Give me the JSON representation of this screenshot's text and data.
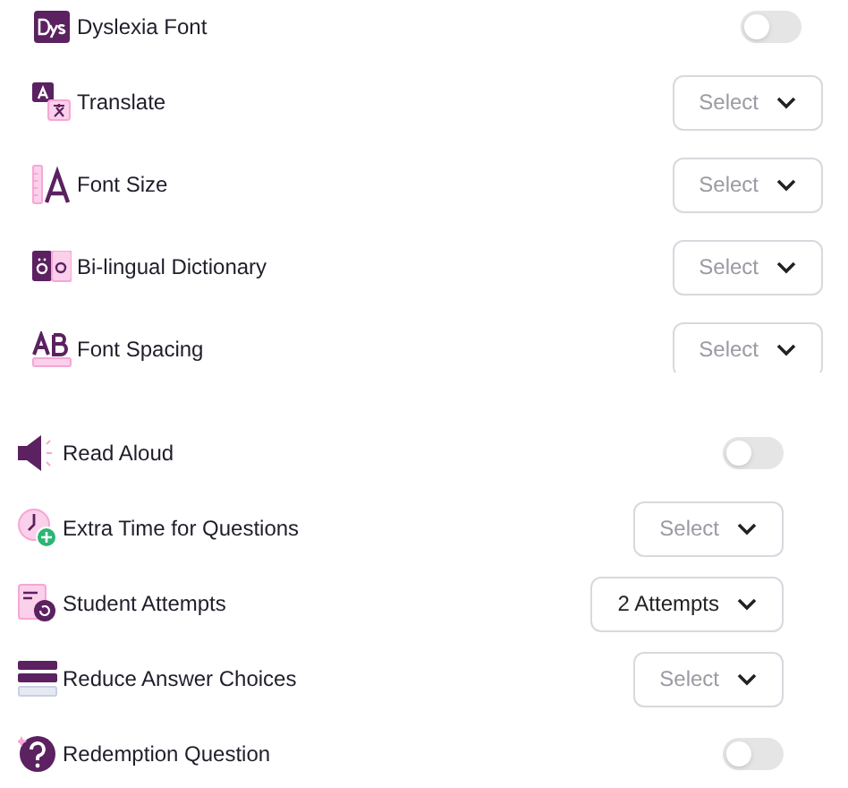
{
  "sections": [
    {
      "items": [
        {
          "kind": "toggle",
          "label": "Dyslexia Font",
          "on": false
        },
        {
          "kind": "select",
          "label": "Translate",
          "placeholder": "Select"
        },
        {
          "kind": "select",
          "label": "Font Size",
          "placeholder": "Select"
        },
        {
          "kind": "select",
          "label": "Bi-lingual Dictionary",
          "placeholder": "Select"
        },
        {
          "kind": "select",
          "label": "Font Spacing",
          "placeholder": "Select"
        }
      ]
    },
    {
      "items": [
        {
          "kind": "toggle",
          "label": "Read Aloud",
          "on": false
        },
        {
          "kind": "select",
          "label": "Extra Time for Questions",
          "placeholder": "Select"
        },
        {
          "kind": "select",
          "label": "Student Attempts",
          "value": "2 Attempts"
        },
        {
          "kind": "select",
          "label": "Reduce Answer Choices",
          "placeholder": "Select"
        },
        {
          "kind": "toggle",
          "label": "Redemption Question",
          "on": false
        }
      ]
    }
  ]
}
